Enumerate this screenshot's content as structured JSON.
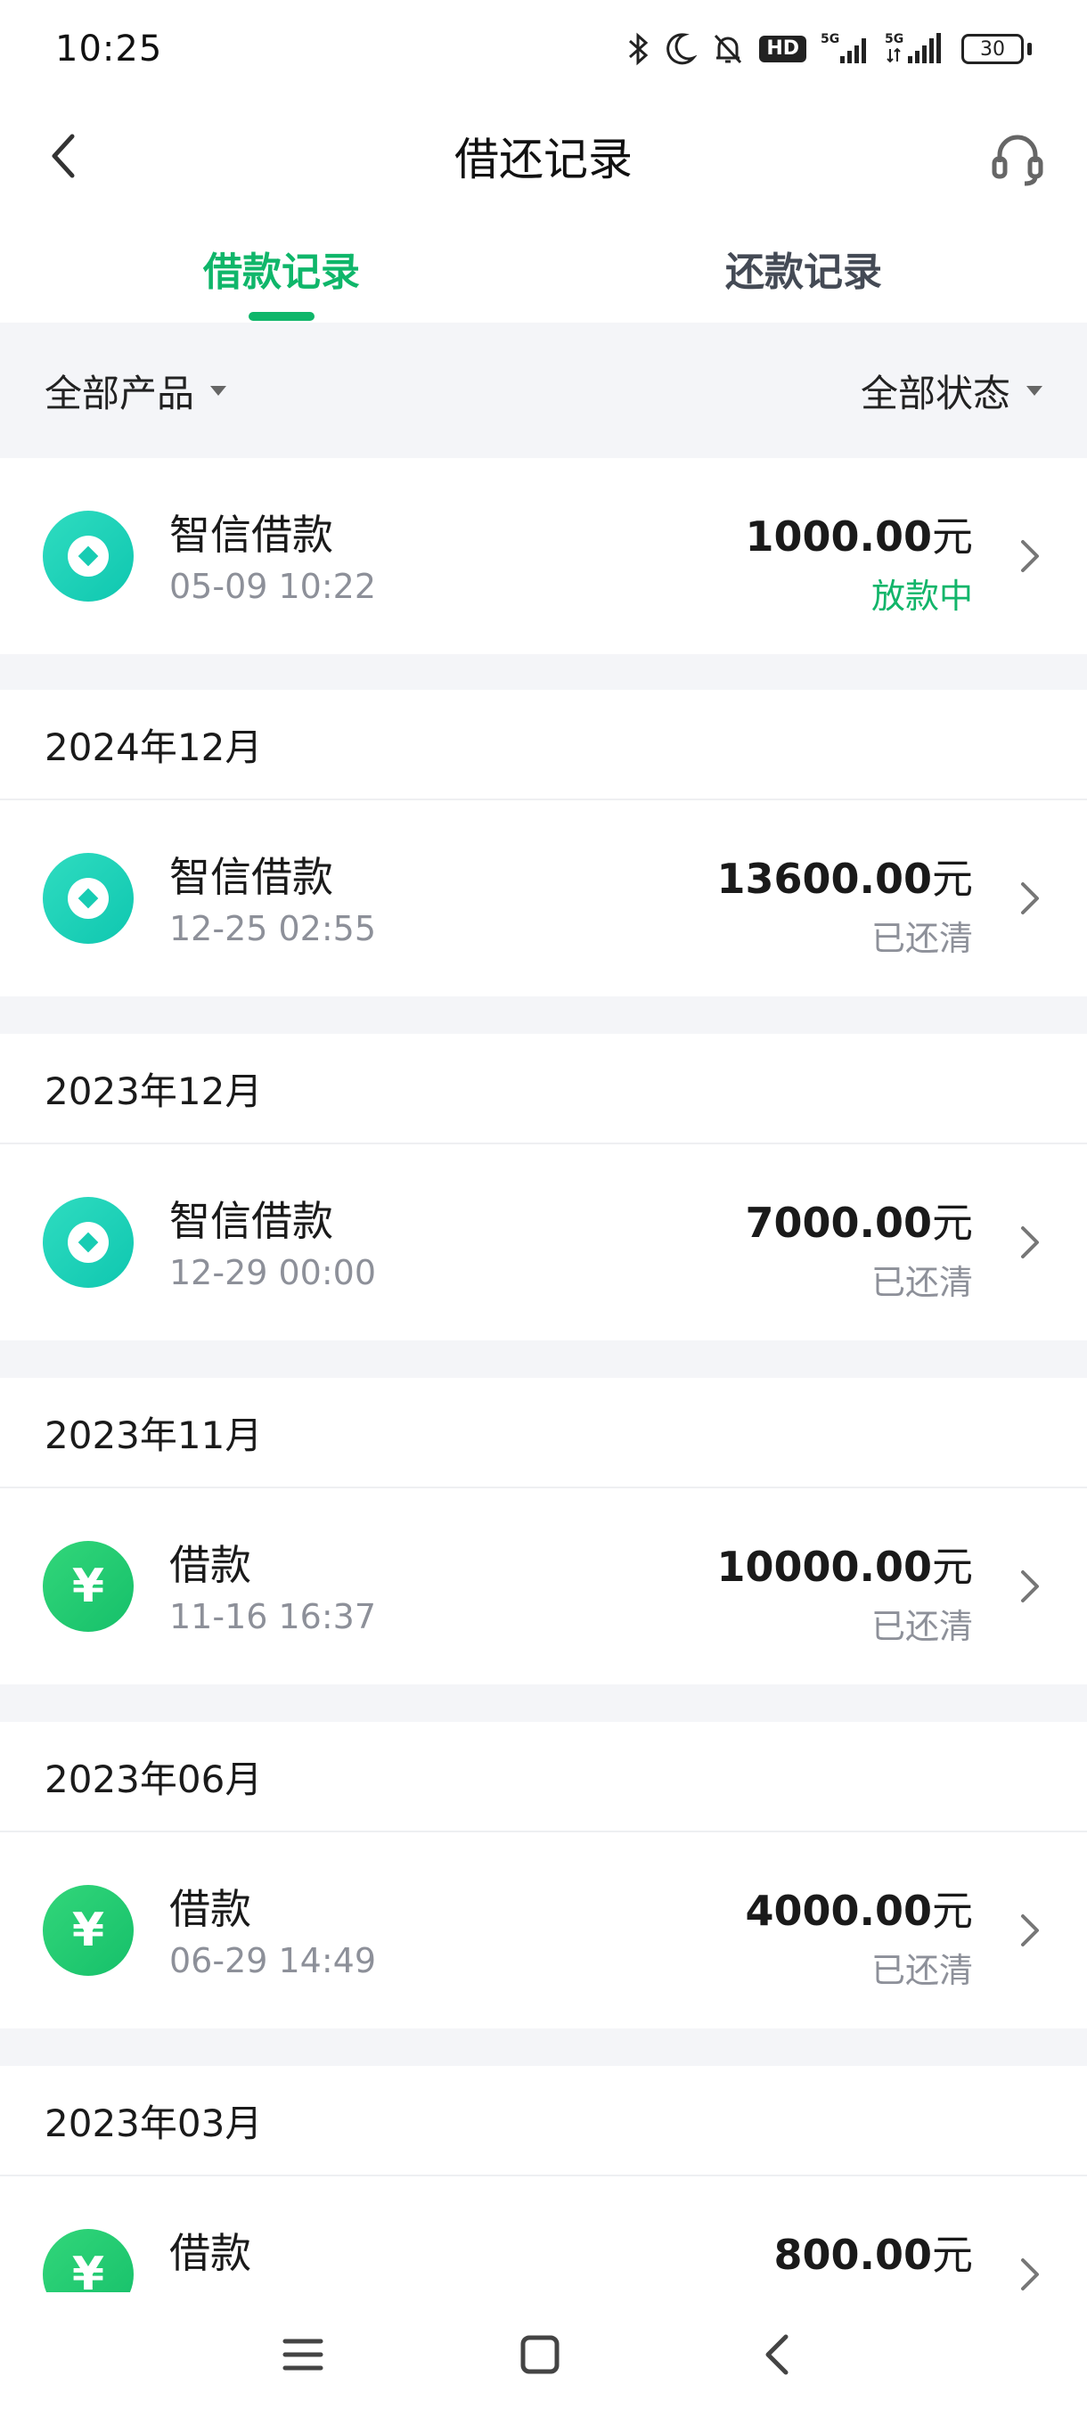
{
  "status_bar": {
    "time": "10:25",
    "network_1": "5G",
    "network_2": "5G",
    "hd_label": "HD",
    "battery": "30"
  },
  "header": {
    "title": "借还记录"
  },
  "tabs": [
    {
      "label": "借款记录",
      "active": true
    },
    {
      "label": "还款记录",
      "active": false
    }
  ],
  "filters": {
    "product": "全部产品",
    "status": "全部状态"
  },
  "records": [
    {
      "month": "",
      "icon": "zhixin-coin-icon",
      "name": "智信借款",
      "time": "05-09 10:22",
      "amount": "1000.00",
      "unit": "元",
      "status": "放款中"
    },
    {
      "month": "2024年12月",
      "icon": "zhixin-coin-icon",
      "name": "智信借款",
      "time": "12-25 02:55",
      "amount": "13600.00",
      "unit": "元",
      "status": "已还清"
    },
    {
      "month": "2023年12月",
      "icon": "zhixin-coin-icon",
      "name": "智信借款",
      "time": "12-29 00:00",
      "amount": "7000.00",
      "unit": "元",
      "status": "已还清"
    },
    {
      "month": "2023年11月",
      "icon": "yen-icon",
      "name": "借款",
      "time": "11-16 16:37",
      "amount": "10000.00",
      "unit": "元",
      "status": "已还清"
    },
    {
      "month": "2023年06月",
      "icon": "yen-icon",
      "name": "借款",
      "time": "06-29 14:49",
      "amount": "4000.00",
      "unit": "元",
      "status": "已还清"
    },
    {
      "month": "2023年03月",
      "icon": "yen-icon",
      "name": "借款",
      "time": "",
      "amount": "800.00",
      "unit": "元",
      "status": ""
    }
  ],
  "colors": {
    "accent": "#0fb66a",
    "teal_icon": "#17ccb3",
    "green_icon": "#16c06a",
    "background": "#f4f5f8"
  }
}
